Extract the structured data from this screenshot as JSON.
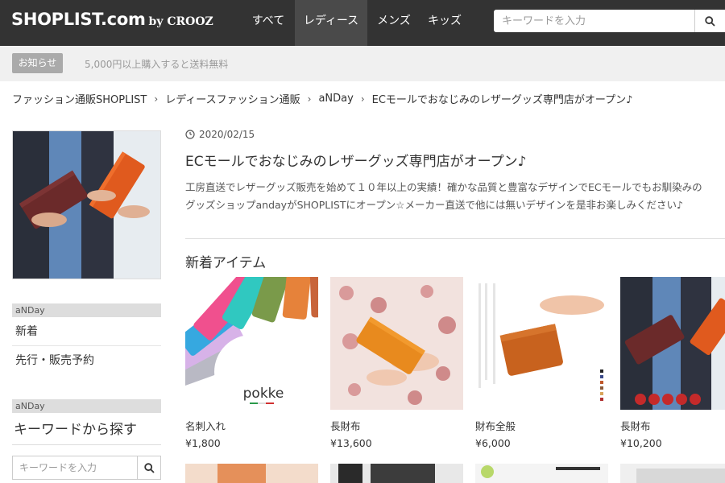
{
  "header": {
    "logo_main": "SHOPLIST.com",
    "logo_by": "by CROOZ",
    "nav": [
      "すべて",
      "レディース",
      "メンズ",
      "キッズ"
    ],
    "active_nav": "レディース",
    "search_placeholder": "キーワードを入力"
  },
  "notice": {
    "badge": "お知らせ",
    "text": "5,000円以上購入すると送料無料"
  },
  "breadcrumb": [
    "ファッション通販SHOPLIST",
    "レディースファッション通販",
    "aNDay",
    "ECモールでおなじみのレザーグッズ専門店がオープン♪"
  ],
  "sidebar": {
    "section1_header": "aNDay",
    "links": [
      "新着",
      "先行・販売予約"
    ],
    "section2_header": "aNDay",
    "search_title": "キーワードから探す",
    "search_placeholder": "キーワードを入力"
  },
  "article": {
    "date": "2020/02/15",
    "title": "ECモールでおなじみのレザーグッズ専門店がオープン♪",
    "desc_line1": "工房直送でレザーグッズ販売を始めて１０年以上の実績！確かな品質と豊富なデザインでECモールでもお馴染みの",
    "desc_line2": "グッズショップandayがSHOPLISTにオープン☆メーカー直送で他には無いデザインを是非お楽しみください♪"
  },
  "new_items": {
    "title": "新着アイテム",
    "items": [
      {
        "name": "名刺入れ",
        "price": "¥1,800",
        "image_text": "pokke"
      },
      {
        "name": "長財布",
        "price": "¥13,600"
      },
      {
        "name": "財布全般",
        "price": "¥6,000"
      },
      {
        "name": "長財布",
        "price": "¥10,200"
      }
    ]
  },
  "colors": {
    "header_bg": "#333333",
    "active_nav_bg": "#4a4a4a",
    "notice_bg": "#f0f0f0",
    "badge_bg": "#aaaaaa"
  }
}
